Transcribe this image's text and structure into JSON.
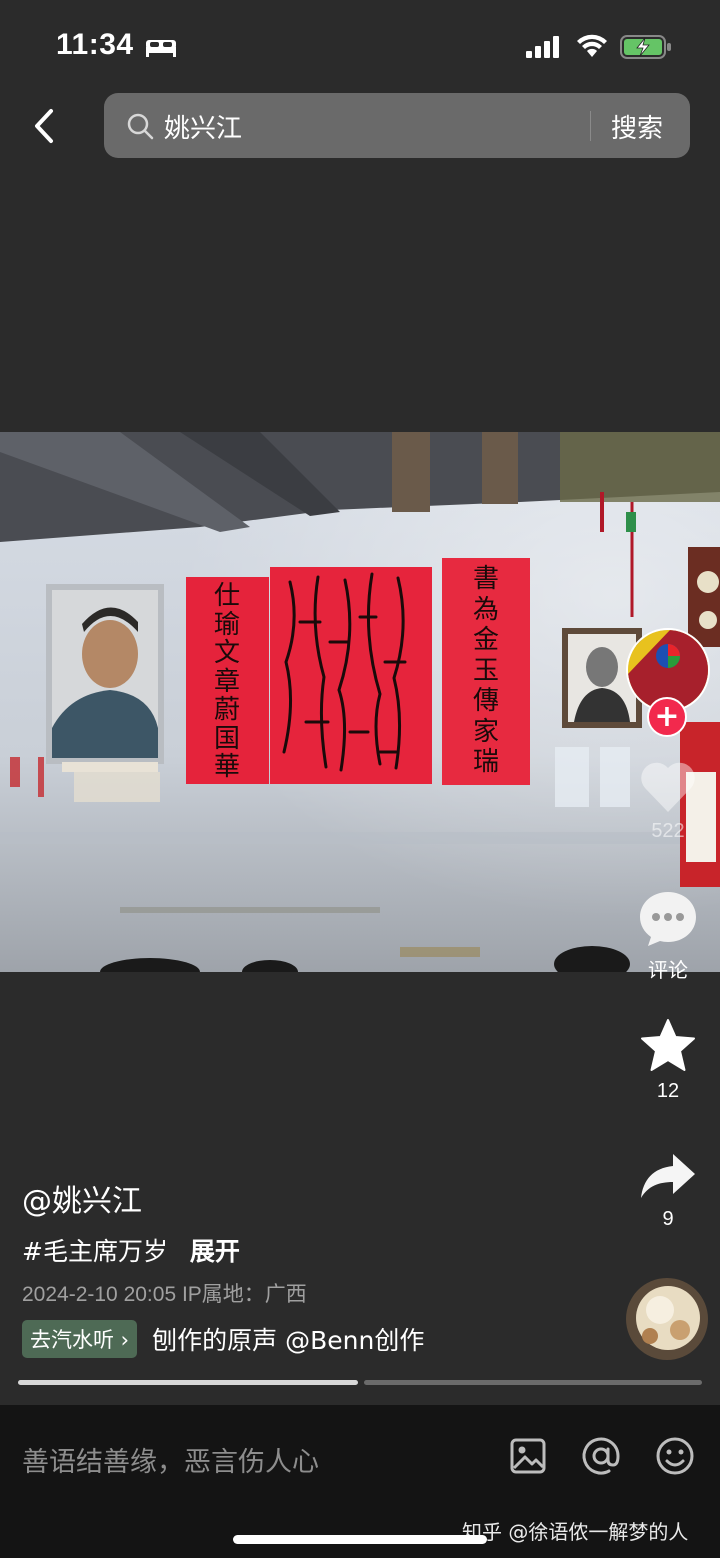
{
  "status_bar": {
    "time": "11:34"
  },
  "search": {
    "query": "姚兴江",
    "button_label": "搜索"
  },
  "video": {
    "couplet_left": "仕瑜文章蔚国華",
    "couplet_right": "書為金玉傳家瑞"
  },
  "actions": {
    "like_count": "522",
    "comment_label": "评论",
    "favorite_count": "12",
    "share_count": "9"
  },
  "post": {
    "author": "@姚兴江",
    "hashtag": "#毛主席万岁",
    "expand_label": "展开",
    "meta": "2024-2-10 20:05  IP属地：广西",
    "music_chip": "去汽水听 ›",
    "music_text": "刨作的原声    @Benn创作"
  },
  "comment_bar": {
    "placeholder": "善语结善缘，恶言伤人心",
    "watermark": "知乎 @徐语侬一解梦的人"
  },
  "colors": {
    "follow": "#f2294d",
    "battery": "#65c466",
    "chip": "#4e6a55"
  }
}
